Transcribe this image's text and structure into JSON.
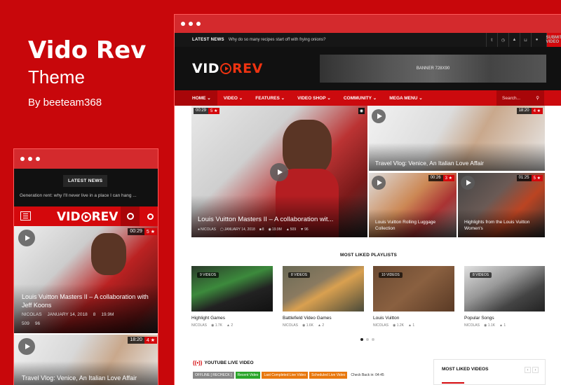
{
  "promo": {
    "title": "Vido Rev",
    "subtitle": "Theme",
    "author": "By beeteam368"
  },
  "desktop": {
    "ticker": {
      "label": "LATEST NEWS",
      "text": "Why do so many recipes start off with frying onions?",
      "submit": "SUBMIT VIDEO",
      "icons": [
        "twitter-icon",
        "clock-icon",
        "bell-icon",
        "cart-icon",
        "user-icon"
      ]
    },
    "logo": {
      "vid": "VID",
      "rev": "REV"
    },
    "banner": "BANNER 728X90",
    "nav": {
      "items": [
        "HOME",
        "VIDEO",
        "FEATURES",
        "VIDEO SHOP",
        "COMMUNITY",
        "MEGA MENU"
      ],
      "search_placeholder": "Search..."
    },
    "featured": {
      "main": {
        "time": "00:29",
        "rating": "5 ★",
        "title": "Louis Vuitton Masters II – A collaboration wit...",
        "author": "NICOLAS",
        "date": "JANUARY 14, 2018",
        "comments": "8",
        "views": "19.9M",
        "likes": "509",
        "dislikes": "96"
      },
      "top_right": {
        "time": "18:20",
        "rating": "4 ★",
        "title": "Travel Vlog: Venice, An Italian Love Affair"
      },
      "bottom_left": {
        "time": "00:26",
        "rating": "3 ★",
        "title": "Louis Vuitton Rolling Luggage Collection"
      },
      "bottom_right": {
        "time": "01:25",
        "rating": "5 ★",
        "title": "Highlights from the Louis Vuitton Women's"
      }
    },
    "playlists": {
      "title": "MOST LIKED PLAYLISTS",
      "items": [
        {
          "count": "9 VIDEOS",
          "name": "Highlight Games",
          "author": "NICOLAS",
          "views": "1.7K",
          "likes": "2"
        },
        {
          "count": "8 VIDEOS",
          "name": "Battlefield Video Games",
          "author": "NICOLAS",
          "views": "1.6K",
          "likes": "2"
        },
        {
          "count": "10 VIDEOS",
          "name": "Louis Vuitton",
          "author": "NICOLAS",
          "views": "1.2K",
          "likes": "1"
        },
        {
          "count": "8 VIDEOS",
          "name": "Popular Songs",
          "author": "NICOLAS",
          "views": "1.1K",
          "likes": "1"
        }
      ]
    },
    "live": {
      "title": "YOUTUBE LIVE VIDEO",
      "buttons": [
        "OFFLINE [ RECHECK ]",
        "Recent Video",
        "Last Completed Live Video",
        "Scheduled Live Video"
      ],
      "check": "Check Back in: 04:45"
    },
    "most_liked_videos": "MOST LIKED VIDEOS"
  },
  "mobile": {
    "latest": "LATEST NEWS",
    "ticker": "Generation rent: why I'll never live in a place I can hang ...",
    "logo": {
      "vid": "VID",
      "rev": "REV"
    },
    "video1": {
      "time": "00:29",
      "rating": "5 ★",
      "title": "Louis Vuitton Masters II – A collaboration with Jeff Koons",
      "author": "NICOLAS",
      "date": "JANUARY 14, 2018",
      "comments": "8",
      "views": "19.9M",
      "likes": "509",
      "dislikes": "96"
    },
    "video2": {
      "time": "18:20",
      "rating": "4 ★",
      "title": "Travel Vlog: Venice, An Italian Love Affair"
    }
  },
  "colors": {
    "brand": "#c8070b",
    "accent": "#d4080c",
    "dark": "#111111"
  }
}
